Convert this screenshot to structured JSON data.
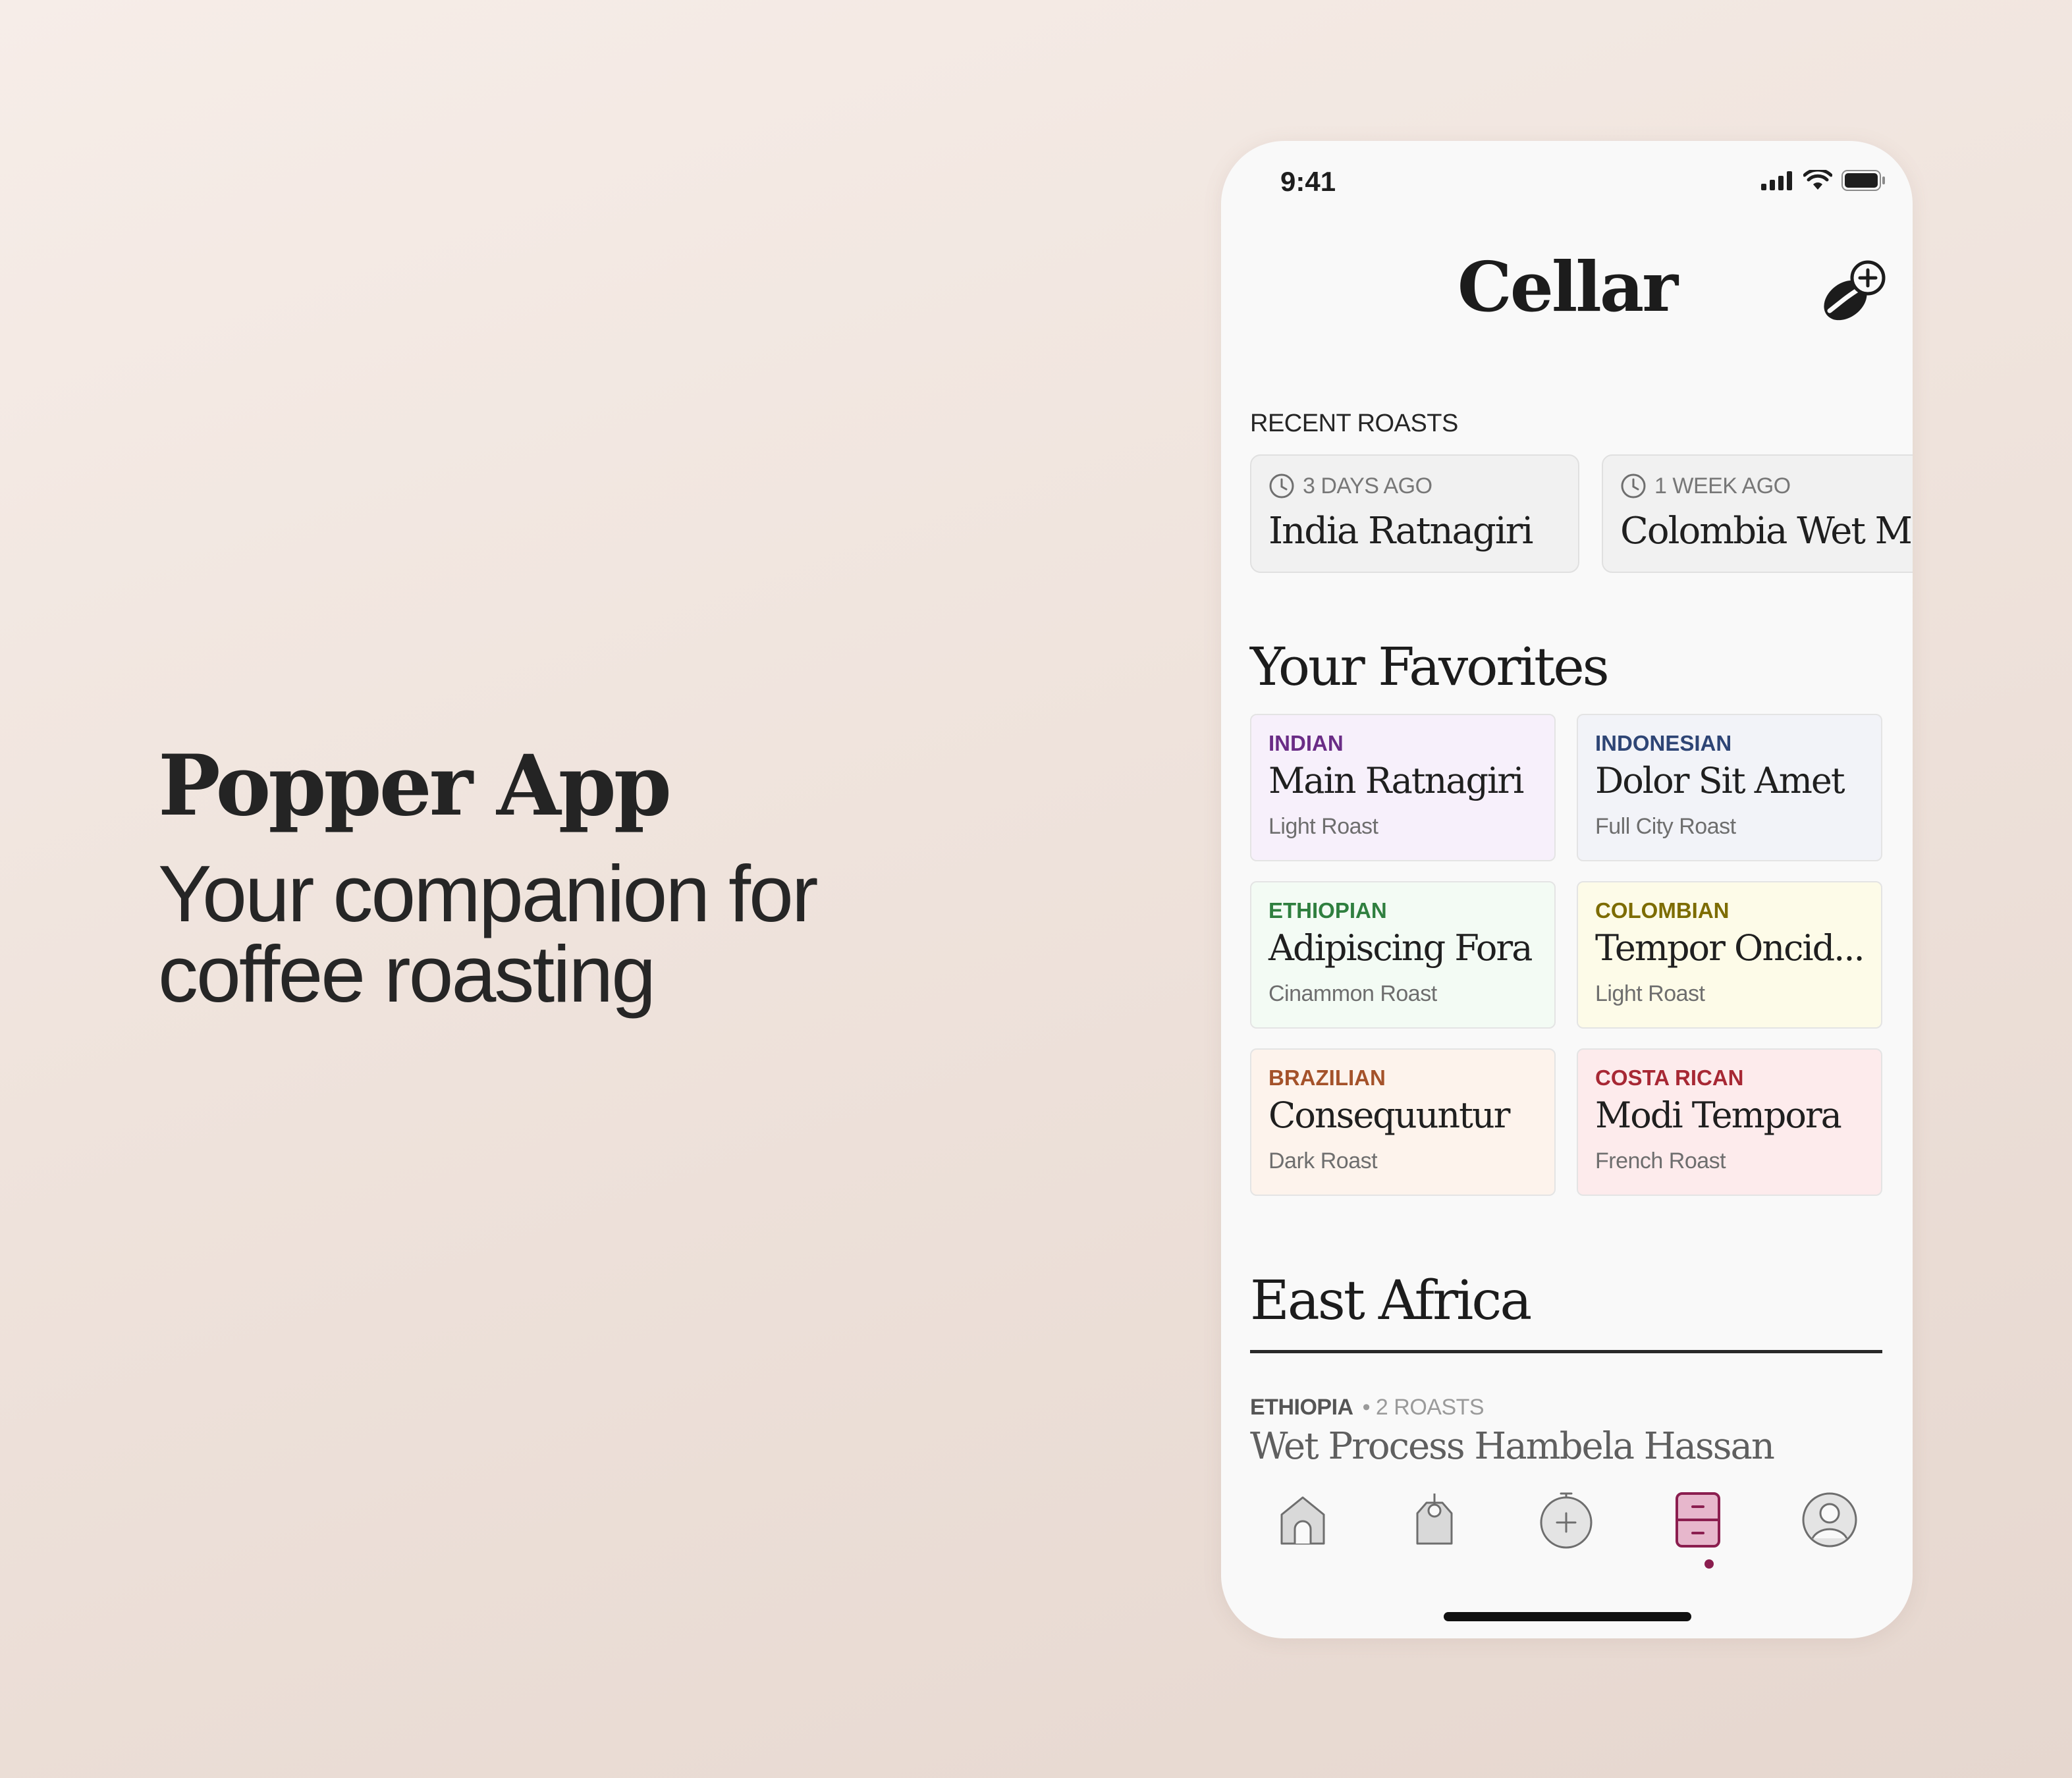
{
  "promo": {
    "title": "Popper App",
    "subtitle": "Your companion for coffee roasting"
  },
  "status_bar": {
    "time": "9:41",
    "icons": [
      "signal-icon",
      "wifi-icon",
      "battery-icon"
    ]
  },
  "header": {
    "title": "Cellar",
    "action_icon": "add-bean-icon"
  },
  "recent": {
    "label": "RECENT ROASTS",
    "items": [
      {
        "time": "3 DAYS AGO",
        "name": "India Ratnagiri"
      },
      {
        "time": "1 WEEK AGO",
        "name": "Colombia Wet Mix"
      }
    ]
  },
  "favorites": {
    "heading": "Your Favorites",
    "items": [
      {
        "origin": "INDIAN",
        "name": "Main Ratnagiri",
        "roast": "Light Roast",
        "bg": "#f7f0fb",
        "accent": "#6a2c86"
      },
      {
        "origin": "INDONESIAN",
        "name": "Dolor Sit Amet",
        "roast": "Full City Roast",
        "bg": "#f2f3f8",
        "accent": "#2e4575"
      },
      {
        "origin": "ETHIOPIAN",
        "name": "Adipiscing Fora",
        "roast": "Cinammon Roast",
        "bg": "#f3fbf4",
        "accent": "#2f7f3f"
      },
      {
        "origin": "COLOMBIAN",
        "name": "Tempor Oncid...",
        "roast": "Light Roast",
        "bg": "#fdfbe8",
        "accent": "#7d6c00"
      },
      {
        "origin": "BRAZILIAN",
        "name": "Consequuntur",
        "roast": "Dark Roast",
        "bg": "#fdf3ec",
        "accent": "#a4522a"
      },
      {
        "origin": "COSTA RICAN",
        "name": "Modi Tempora",
        "roast": "French Roast",
        "bg": "#fdebec",
        "accent": "#a72834"
      }
    ]
  },
  "region": {
    "heading": "East Africa",
    "country": "ETHIOPIA",
    "count": "• 2 ROASTS",
    "item": "Wet Process Hambela Hassan"
  },
  "tabbar": {
    "items": [
      {
        "icon": "home-icon",
        "active": false
      },
      {
        "icon": "bag-tag-icon",
        "active": false
      },
      {
        "icon": "add-roast-icon",
        "active": false
      },
      {
        "icon": "cellar-cabinet-icon",
        "active": true
      },
      {
        "icon": "profile-icon",
        "active": false
      }
    ],
    "active_color": "#8b1e4f"
  }
}
